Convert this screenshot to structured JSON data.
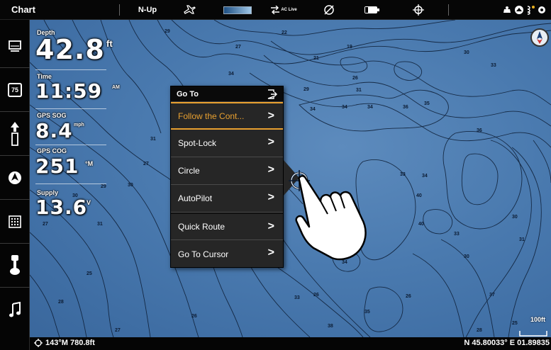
{
  "app": {
    "title": "Chart"
  },
  "topbar": {
    "orientation": "N-Up",
    "ac_live_label": "AC Live",
    "icons": [
      "plane-icon",
      "chart-shading-icon",
      "ac-live-icon",
      "crossed-circle-icon",
      "battery-icon",
      "gps-target-icon",
      "speaker-icon",
      "chart-mode-icon",
      "signal-icon",
      "settings-icon"
    ]
  },
  "sidebar": {
    "items": [
      {
        "name": "views-icon"
      },
      {
        "name": "temperature-icon",
        "label": "75"
      },
      {
        "name": "boat-icon"
      },
      {
        "name": "navigation-icon"
      },
      {
        "name": "keypad-icon"
      },
      {
        "name": "trolling-motor-icon"
      },
      {
        "name": "music-icon"
      }
    ]
  },
  "overlay": {
    "depth": {
      "label": "Depth",
      "value": "42.8",
      "unit": "ft"
    },
    "time": {
      "label": "Time",
      "value": "11:59",
      "unit": "AM"
    },
    "gps_sog": {
      "label": "GPS SOG",
      "value": "8.4",
      "unit": "mph"
    },
    "gps_cog": {
      "label": "GPS COG",
      "value": "251",
      "unit": "°M"
    },
    "supply": {
      "label": "Supply",
      "value": "13.6",
      "unit": "V"
    }
  },
  "goto_menu": {
    "title": "Go To",
    "items": [
      {
        "label": "Follow the Cont...",
        "active": true
      },
      {
        "label": "Spot-Lock"
      },
      {
        "label": "Circle"
      },
      {
        "label": "AutoPilot"
      },
      {
        "label": "Quick Route"
      },
      {
        "label": "Go To Cursor"
      }
    ],
    "chevron": ">"
  },
  "contour_labels": [
    "29",
    "27",
    "21",
    "19",
    "34",
    "26",
    "22",
    "29",
    "31",
    "30",
    "33",
    "34",
    "34",
    "36",
    "34",
    "35",
    "36",
    "33",
    "34",
    "27",
    "30",
    "29",
    "30",
    "27",
    "31",
    "25",
    "28",
    "33",
    "30",
    "30",
    "31",
    "26",
    "26",
    "34",
    "35",
    "27",
    "26",
    "33",
    "40",
    "40",
    "38",
    "37",
    "25",
    "28",
    "29",
    "31"
  ],
  "scale": {
    "label": "100ft"
  },
  "status": {
    "heading": "143°M 780.8ft",
    "position": "N 45.80033° E 01.89835"
  },
  "colors": {
    "water": "#4a7aaf",
    "accent": "#e8a030",
    "menu_bg": "#262626"
  }
}
